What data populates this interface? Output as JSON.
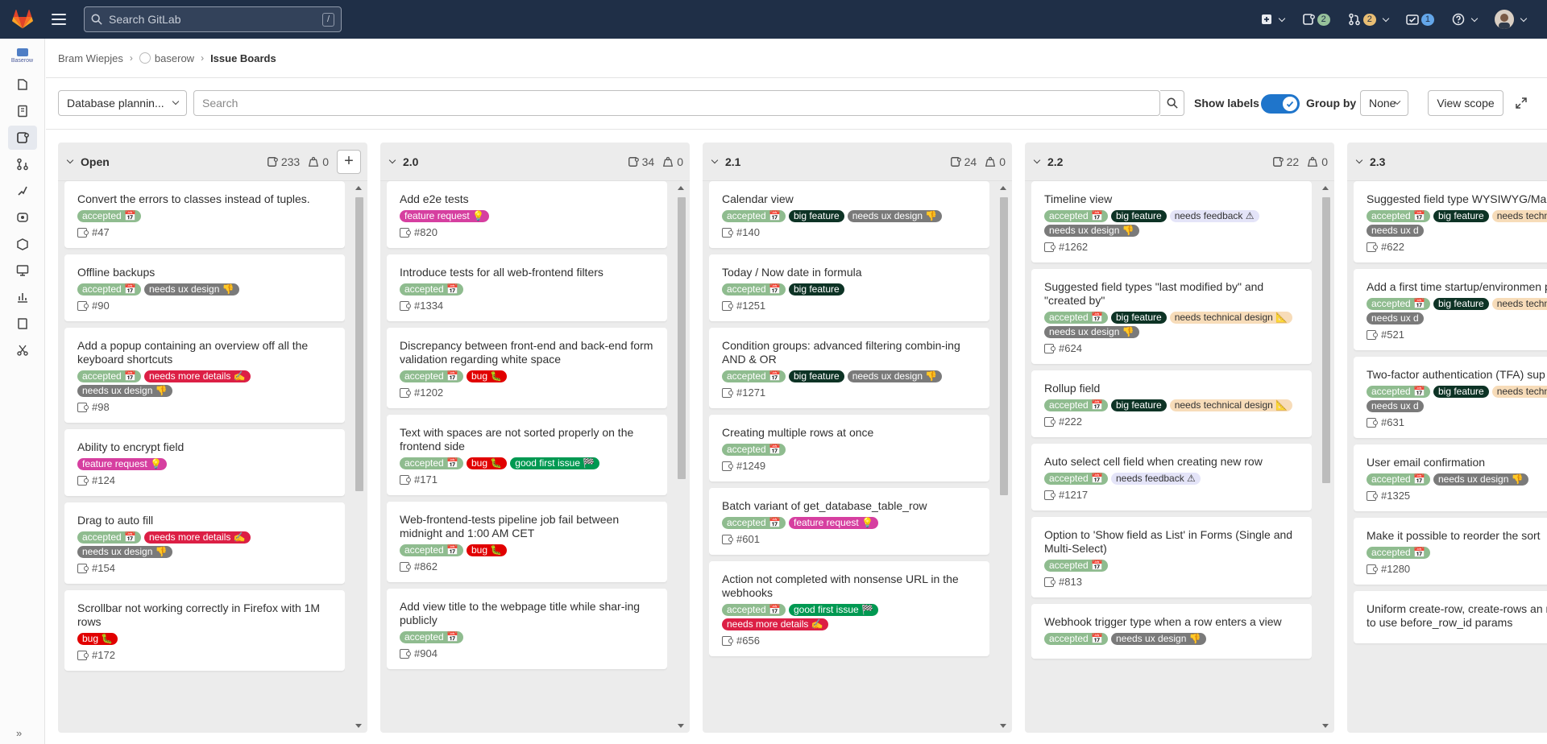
{
  "topbar": {
    "search_placeholder": "Search GitLab",
    "search_shortcut": "/",
    "issues_count": "2",
    "mr_count": "2",
    "todo_count": "1"
  },
  "sidebar": {
    "project_name": "Baserow",
    "icons": [
      "project-overview-icon",
      "repository-icon",
      "issues-icon",
      "merge-requests-icon",
      "ci-cd-icon",
      "deployments-icon",
      "packages-icon",
      "monitor-icon",
      "analytics-icon",
      "wiki-icon",
      "snippets-icon"
    ],
    "collapse_label": "»"
  },
  "breadcrumb": {
    "user": "Bram Wiepjes",
    "project": "baserow",
    "current": "Issue Boards"
  },
  "filterbar": {
    "board_name": "Database plannin...",
    "search_placeholder": "Search",
    "show_labels": "Show labels",
    "group_by": "Group by",
    "group_by_value": "None",
    "view_scope": "View scope"
  },
  "lists": [
    {
      "title": "Open",
      "issues": "233",
      "weight": "0",
      "cards": [
        {
          "title": "Convert the errors to classes instead of tuples.",
          "labels": [
            [
              "accepted 📅",
              "accepted"
            ]
          ],
          "id": "#47"
        },
        {
          "title": "Offline backups",
          "labels": [
            [
              "accepted 📅",
              "accepted"
            ],
            [
              "needs ux design 👎",
              "ux"
            ]
          ],
          "id": "#90"
        },
        {
          "title": "Add a popup containing an overview off all the keyboard shortcuts",
          "labels": [
            [
              "accepted 📅",
              "accepted"
            ],
            [
              "needs more details ✍",
              "more"
            ],
            [
              "needs ux design 👎",
              "ux"
            ]
          ],
          "id": "#98"
        },
        {
          "title": "Ability to encrypt field",
          "labels": [
            [
              "feature request 💡",
              "fr"
            ]
          ],
          "id": "#124"
        },
        {
          "title": "Drag to auto fill",
          "labels": [
            [
              "accepted 📅",
              "accepted"
            ],
            [
              "needs more details ✍",
              "more"
            ],
            [
              "needs ux design 👎",
              "ux"
            ]
          ],
          "id": "#154"
        },
        {
          "title": "Scrollbar not working correctly in Firefox with 1M rows",
          "labels": [
            [
              "bug 🐛",
              "bug"
            ]
          ],
          "id": "#172"
        }
      ]
    },
    {
      "title": "2.0",
      "issues": "34",
      "weight": "0",
      "cards": [
        {
          "title": "Add e2e tests",
          "labels": [
            [
              "feature request 💡",
              "fr"
            ]
          ],
          "id": "#820"
        },
        {
          "title": "Introduce tests for all web-frontend filters",
          "labels": [
            [
              "accepted 📅",
              "accepted"
            ]
          ],
          "id": "#1334"
        },
        {
          "title": "Discrepancy between front-end and back-end form validation regarding white space",
          "labels": [
            [
              "accepted 📅",
              "accepted"
            ],
            [
              "bug 🐛",
              "bug"
            ]
          ],
          "id": "#1202"
        },
        {
          "title": "Text with spaces are not sorted properly on the frontend side",
          "labels": [
            [
              "accepted 📅",
              "accepted"
            ],
            [
              "bug 🐛",
              "bug"
            ],
            [
              "good first issue 🏁",
              "good"
            ]
          ],
          "id": "#171"
        },
        {
          "title": "Web-frontend-tests pipeline job fail between midnight and 1:00 AM CET",
          "labels": [
            [
              "accepted 📅",
              "accepted"
            ],
            [
              "bug 🐛",
              "bug"
            ]
          ],
          "id": "#862"
        },
        {
          "title": "Add view title to the webpage title while shar-ing publicly",
          "labels": [
            [
              "accepted 📅",
              "accepted"
            ]
          ],
          "id": "#904"
        }
      ]
    },
    {
      "title": "2.1",
      "issues": "24",
      "weight": "0",
      "cards": [
        {
          "title": "Calendar view",
          "labels": [
            [
              "accepted 📅",
              "accepted"
            ],
            [
              "big feature",
              "big"
            ],
            [
              "needs ux design 👎",
              "ux"
            ]
          ],
          "id": "#140"
        },
        {
          "title": "Today / Now date in formula",
          "labels": [
            [
              "accepted 📅",
              "accepted"
            ],
            [
              "big feature",
              "big"
            ]
          ],
          "id": "#1251"
        },
        {
          "title": "Condition groups: advanced filtering combin-ing AND & OR",
          "labels": [
            [
              "accepted 📅",
              "accepted"
            ],
            [
              "big feature",
              "big"
            ],
            [
              "needs ux design 👎",
              "ux"
            ]
          ],
          "id": "#1271"
        },
        {
          "title": "Creating multiple rows at once",
          "labels": [
            [
              "accepted 📅",
              "accepted"
            ]
          ],
          "id": "#1249"
        },
        {
          "title": "Batch variant of get_database_table_row",
          "labels": [
            [
              "accepted 📅",
              "accepted"
            ],
            [
              "feature request 💡",
              "fr"
            ]
          ],
          "id": "#601"
        },
        {
          "title": "Action not completed with nonsense URL in the webhooks",
          "labels": [
            [
              "accepted 📅",
              "accepted"
            ],
            [
              "good first issue 🏁",
              "good"
            ],
            [
              "needs more details ✍",
              "more"
            ]
          ],
          "id": "#656"
        }
      ]
    },
    {
      "title": "2.2",
      "issues": "22",
      "weight": "0",
      "cards": [
        {
          "title": "Timeline view",
          "labels": [
            [
              "accepted 📅",
              "accepted"
            ],
            [
              "big feature",
              "big"
            ],
            [
              "needs feedback ⚠",
              "feedback"
            ],
            [
              "needs ux design 👎",
              "ux"
            ]
          ],
          "id": "#1262"
        },
        {
          "title": "Suggested field types \"last modified by\" and \"created by\"",
          "labels": [
            [
              "accepted 📅",
              "accepted"
            ],
            [
              "big feature",
              "big"
            ],
            [
              "needs technical design 📐",
              "tech"
            ],
            [
              "needs ux design 👎",
              "ux"
            ]
          ],
          "id": "#624"
        },
        {
          "title": "Rollup field",
          "labels": [
            [
              "accepted 📅",
              "accepted"
            ],
            [
              "big feature",
              "big"
            ],
            [
              "needs technical design 📐",
              "tech"
            ]
          ],
          "id": "#222"
        },
        {
          "title": "Auto select cell field when creating new row",
          "labels": [
            [
              "accepted 📅",
              "accepted"
            ],
            [
              "needs feedback ⚠",
              "feedback"
            ]
          ],
          "id": "#1217"
        },
        {
          "title": "Option to 'Show field as List' in Forms (Single and Multi-Select)",
          "labels": [
            [
              "accepted 📅",
              "accepted"
            ]
          ],
          "id": "#813"
        },
        {
          "title": "Webhook trigger type when a row enters a view",
          "labels": [
            [
              "accepted 📅",
              "accepted"
            ],
            [
              "needs ux design 👎",
              "ux"
            ]
          ],
          "id": ""
        }
      ]
    },
    {
      "title": "2.3",
      "issues": "",
      "weight": "",
      "cards": [
        {
          "title": "Suggested field type WYSIWYG/Ma support",
          "labels": [
            [
              "accepted 📅",
              "accepted"
            ],
            [
              "big feature",
              "big"
            ],
            [
              "needs technical design 📐",
              "tech"
            ],
            [
              "needs ux d",
              "ux"
            ]
          ],
          "id": "#622"
        },
        {
          "title": "Add a first time startup/environmen page",
          "labels": [
            [
              "accepted 📅",
              "accepted"
            ],
            [
              "big feature",
              "big"
            ],
            [
              "needs technical design 📐",
              "tech"
            ],
            [
              "needs ux d",
              "ux"
            ]
          ],
          "id": "#521"
        },
        {
          "title": "Two-factor authentication (TFA) sup",
          "labels": [
            [
              "accepted 📅",
              "accepted"
            ],
            [
              "big feature",
              "big"
            ],
            [
              "needs technical design 📐",
              "tech"
            ],
            [
              "needs ux d",
              "ux"
            ]
          ],
          "id": "#631"
        },
        {
          "title": "User email confirmation",
          "labels": [
            [
              "accepted 📅",
              "accepted"
            ],
            [
              "needs ux design 👎",
              "ux"
            ]
          ],
          "id": "#1325"
        },
        {
          "title": "Make it possible to reorder the sort",
          "labels": [
            [
              "accepted 📅",
              "accepted"
            ]
          ],
          "id": "#1280"
        },
        {
          "title": "Uniform create-row, create-rows an row endpoints to use before_row_id params",
          "labels": [],
          "id": ""
        }
      ]
    }
  ]
}
